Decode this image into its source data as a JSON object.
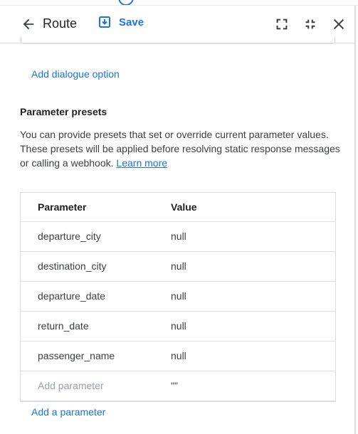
{
  "toolbar": {
    "title": "Route",
    "save_label": "Save",
    "icons": [
      "arrow-back-icon",
      "save-icon",
      "fullscreen-icon",
      "fullscreen-exit-icon",
      "close-icon"
    ]
  },
  "links": {
    "add_dialogue_option": "Add dialogue option",
    "add_parameter": "Add a parameter"
  },
  "presets": {
    "title": "Parameter presets",
    "description": "You can provide presets that set or override current parameter values. These presets will be applied before resolving static response messages or calling a webhook. ",
    "learn_more": "Learn more"
  },
  "table": {
    "headers": [
      "Parameter",
      "Value"
    ],
    "rows": [
      {
        "parameter": "departure_city",
        "value": "null"
      },
      {
        "parameter": "destination_city",
        "value": "null"
      },
      {
        "parameter": "departure_date",
        "value": "null"
      },
      {
        "parameter": "return_date",
        "value": "null"
      },
      {
        "parameter": "passenger_name",
        "value": "null"
      }
    ],
    "new_row": {
      "placeholder": "Add parameter",
      "value": "\"\""
    }
  },
  "colors": {
    "accent": "#1a73e8",
    "text": "#3c4043",
    "border": "#dadce0"
  }
}
